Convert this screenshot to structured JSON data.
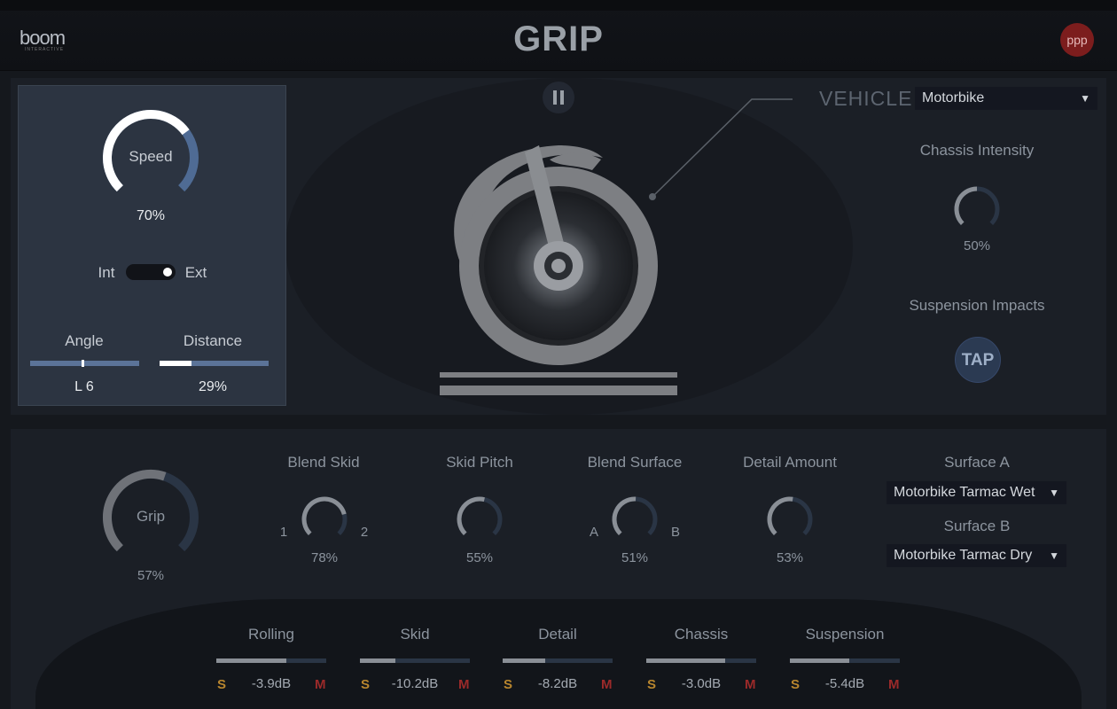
{
  "header": {
    "logo_text": "boom",
    "logo_sub": "INTERACTIVE",
    "title": "GRIP",
    "badge": "ppp"
  },
  "left_panel": {
    "speed": {
      "label": "Speed",
      "value": "70%",
      "level": 0.7
    },
    "toggle": {
      "left": "Int",
      "right": "Ext",
      "state": "Ext"
    },
    "angle": {
      "label": "Angle",
      "value": "L 6"
    },
    "distance": {
      "label": "Distance",
      "value": "29%",
      "level": 0.29
    }
  },
  "center": {
    "pause_icon": "pause-icon",
    "wheel_icon": "motorbike-wheel-icon"
  },
  "vehicle": {
    "label": "VEHICLE",
    "selected": "Motorbike",
    "chassis_intensity": {
      "label": "Chassis Intensity",
      "value": "50%",
      "level": 0.5
    },
    "suspension_impacts": {
      "label": "Suspension Impacts",
      "button": "TAP"
    }
  },
  "controls": {
    "grip": {
      "label": "Grip",
      "value": "57%",
      "level": 0.57
    },
    "blend_skid": {
      "label": "Blend Skid",
      "value": "78%",
      "left": "1",
      "right": "2",
      "level": 0.78
    },
    "skid_pitch": {
      "label": "Skid Pitch",
      "value": "55%",
      "level": 0.55
    },
    "blend_surface": {
      "label": "Blend Surface",
      "value": "51%",
      "left": "A",
      "right": "B",
      "level": 0.51
    },
    "detail_amount": {
      "label": "Detail Amount",
      "value": "53%",
      "level": 0.53
    },
    "surface_a": {
      "label": "Surface A",
      "selected": "Motorbike Tarmac Wet"
    },
    "surface_b": {
      "label": "Surface B",
      "selected": "Motorbike Tarmac Dry"
    }
  },
  "mixer": [
    {
      "label": "Rolling",
      "value": "-3.9dB",
      "solo": "S",
      "mute": "M",
      "level": 0.64
    },
    {
      "label": "Skid",
      "value": "-10.2dB",
      "solo": "S",
      "mute": "M",
      "level": 0.32
    },
    {
      "label": "Detail",
      "value": "-8.2dB",
      "solo": "S",
      "mute": "M",
      "level": 0.39
    },
    {
      "label": "Chassis",
      "value": "-3.0dB",
      "solo": "S",
      "mute": "M",
      "level": 0.72
    },
    {
      "label": "Suspension",
      "value": "-5.4dB",
      "solo": "S",
      "mute": "M",
      "level": 0.54
    }
  ],
  "colors": {
    "accent": "#5b7398",
    "panel": "#2c3441",
    "solo": "#b8862e",
    "mute": "#9b2a2a"
  }
}
